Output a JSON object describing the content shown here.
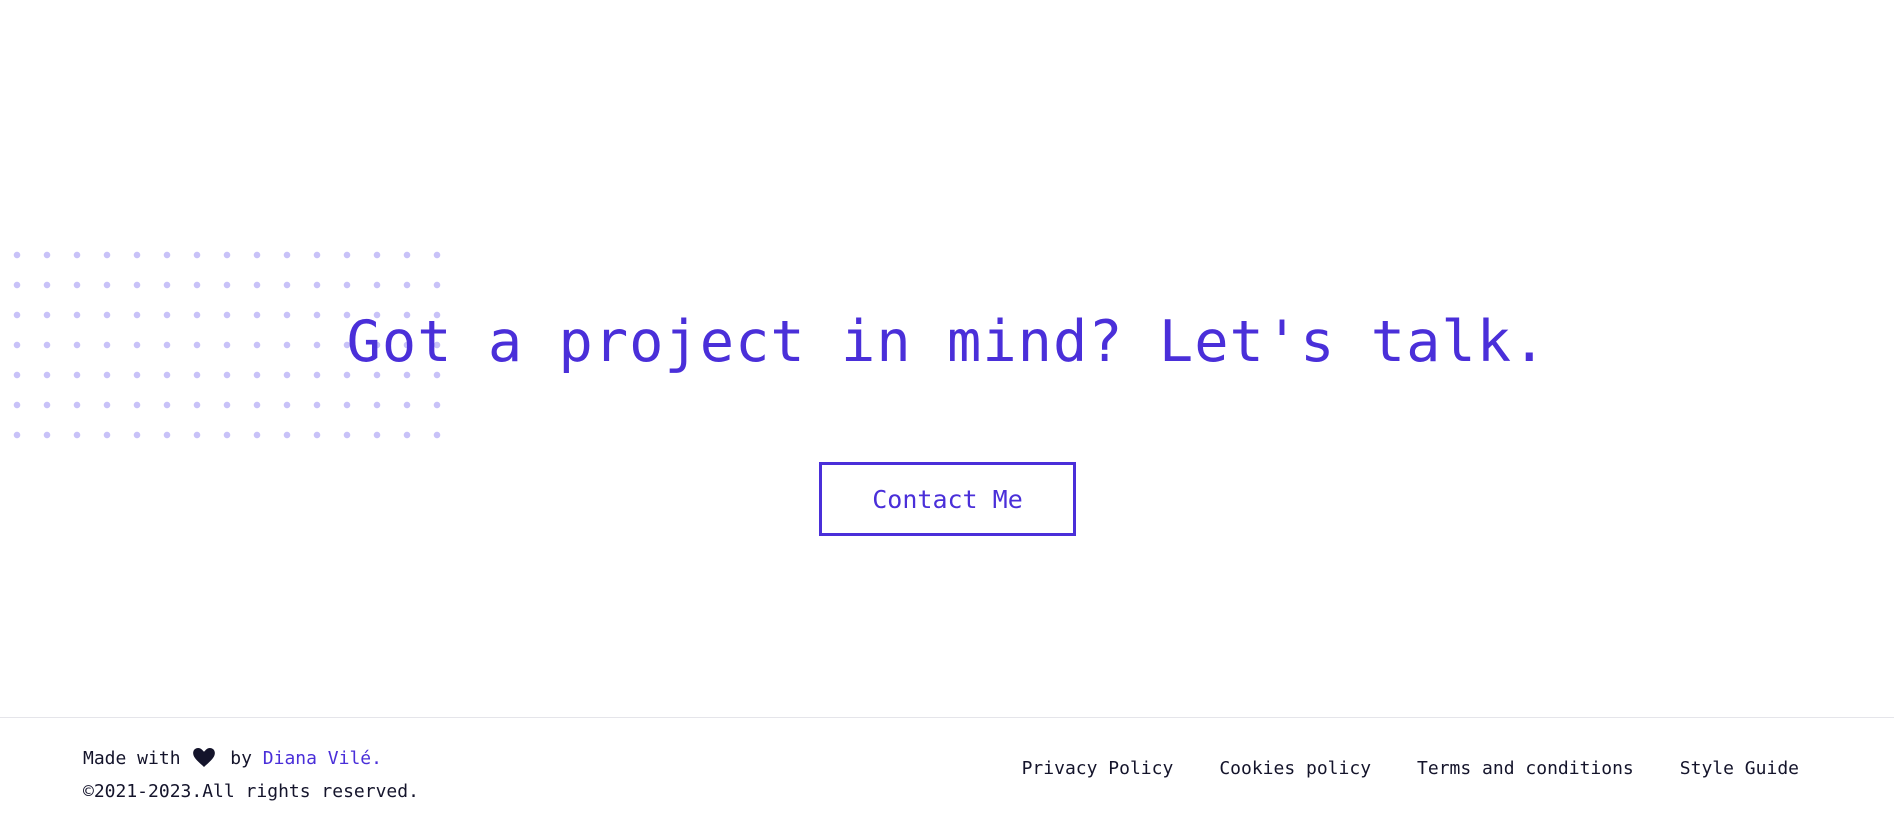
{
  "cta": {
    "headline": "Got a project in mind? Let's talk.",
    "button_label": "Contact Me"
  },
  "footer": {
    "made_with": "Made with",
    "by": "by",
    "author": "Diana Vilé.",
    "copyright": "©2021-2023.All rights reserved.",
    "links": [
      {
        "label": "Privacy Policy"
      },
      {
        "label": "Cookies policy"
      },
      {
        "label": "Terms and conditions"
      },
      {
        "label": "Style Guide"
      }
    ]
  },
  "colors": {
    "accent": "#4a2fd9",
    "dots": "#c8c2f8",
    "text": "#14142b",
    "divider": "#e5e5ea"
  },
  "icons": {
    "heart": "heart-icon"
  }
}
